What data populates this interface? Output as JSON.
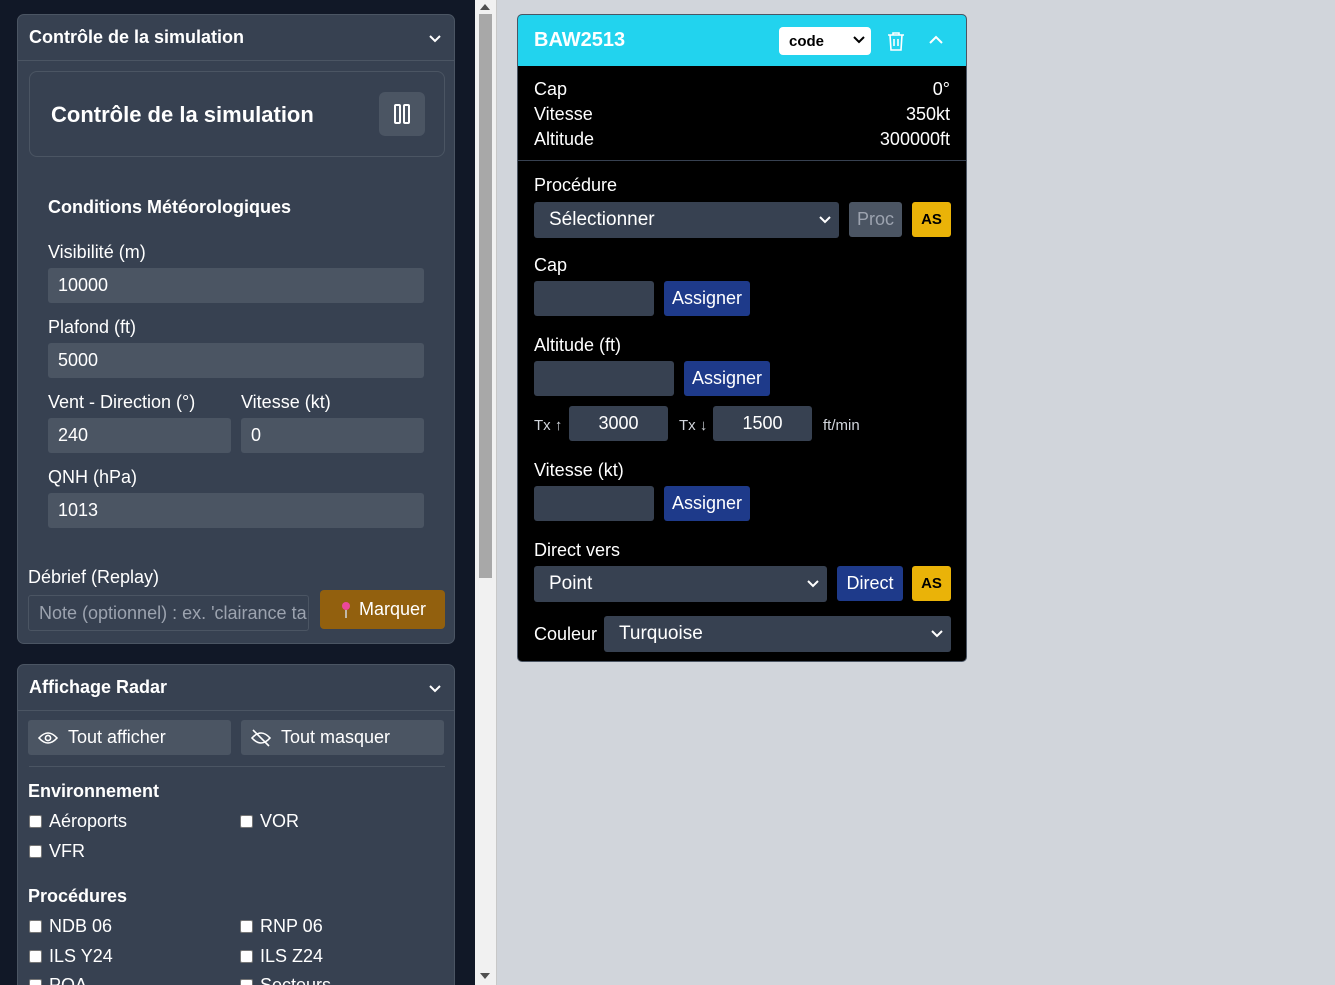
{
  "sim_card": {
    "header": "Contrôle de la simulation",
    "inner_title": "Contrôle de la simulation",
    "pause_icon": "pause-icon",
    "weather_title": "Conditions Météorologiques",
    "visibility_label": "Visibilité (m)",
    "visibility_value": "10000",
    "ceiling_label": "Plafond (ft)",
    "ceiling_value": "5000",
    "wind_dir_label": "Vent - Direction (°)",
    "wind_dir_value": "240",
    "wind_speed_label": "Vitesse (kt)",
    "wind_speed_value": "0",
    "qnh_label": "QNH (hPa)",
    "qnh_value": "1013",
    "debrief_label": "Débrief (Replay)",
    "debrief_placeholder": "Note (optionnel) : ex. 'clairance ta",
    "mark_button": "Marquer",
    "mark_icon": "pin-icon"
  },
  "radar_card": {
    "header": "Affichage Radar",
    "show_all": "Tout afficher",
    "hide_all": "Tout masquer",
    "env_title": "Environnement",
    "env_items": [
      "Aéroports",
      "VOR",
      "VFR"
    ],
    "proc_title": "Procédures",
    "proc_items": [
      "NDB 06",
      "RNP 06",
      "ILS Y24",
      "ILS Z24",
      "POA",
      "Secteurs"
    ]
  },
  "aircraft": {
    "callsign": "BAW2513",
    "code_select": "code",
    "header_color": "#22d3ee",
    "heading_label": "Cap",
    "heading_value": "0°",
    "speed_label": "Vitesse",
    "speed_value": "350kt",
    "altitude_label": "Altitude",
    "altitude_value": "300000ft",
    "procedure_label": "Procédure",
    "procedure_select": "Sélectionner",
    "proc_button": "Proc",
    "as_button": "AS",
    "cap_label": "Cap",
    "cap_value": "",
    "assign_label": "Assigner",
    "alt_label": "Altitude (ft)",
    "alt_value": "",
    "tx_up_label": "Tx ↑",
    "tx_up_value": "3000",
    "tx_down_label": "Tx ↓",
    "tx_down_value": "1500",
    "rate_unit": "ft/min",
    "speed_kt_label": "Vitesse (kt)",
    "speed_kt_value": "",
    "direct_label": "Direct vers",
    "direct_select": "Point",
    "direct_button": "Direct",
    "color_label": "Couleur",
    "color_select": "Turquoise"
  }
}
